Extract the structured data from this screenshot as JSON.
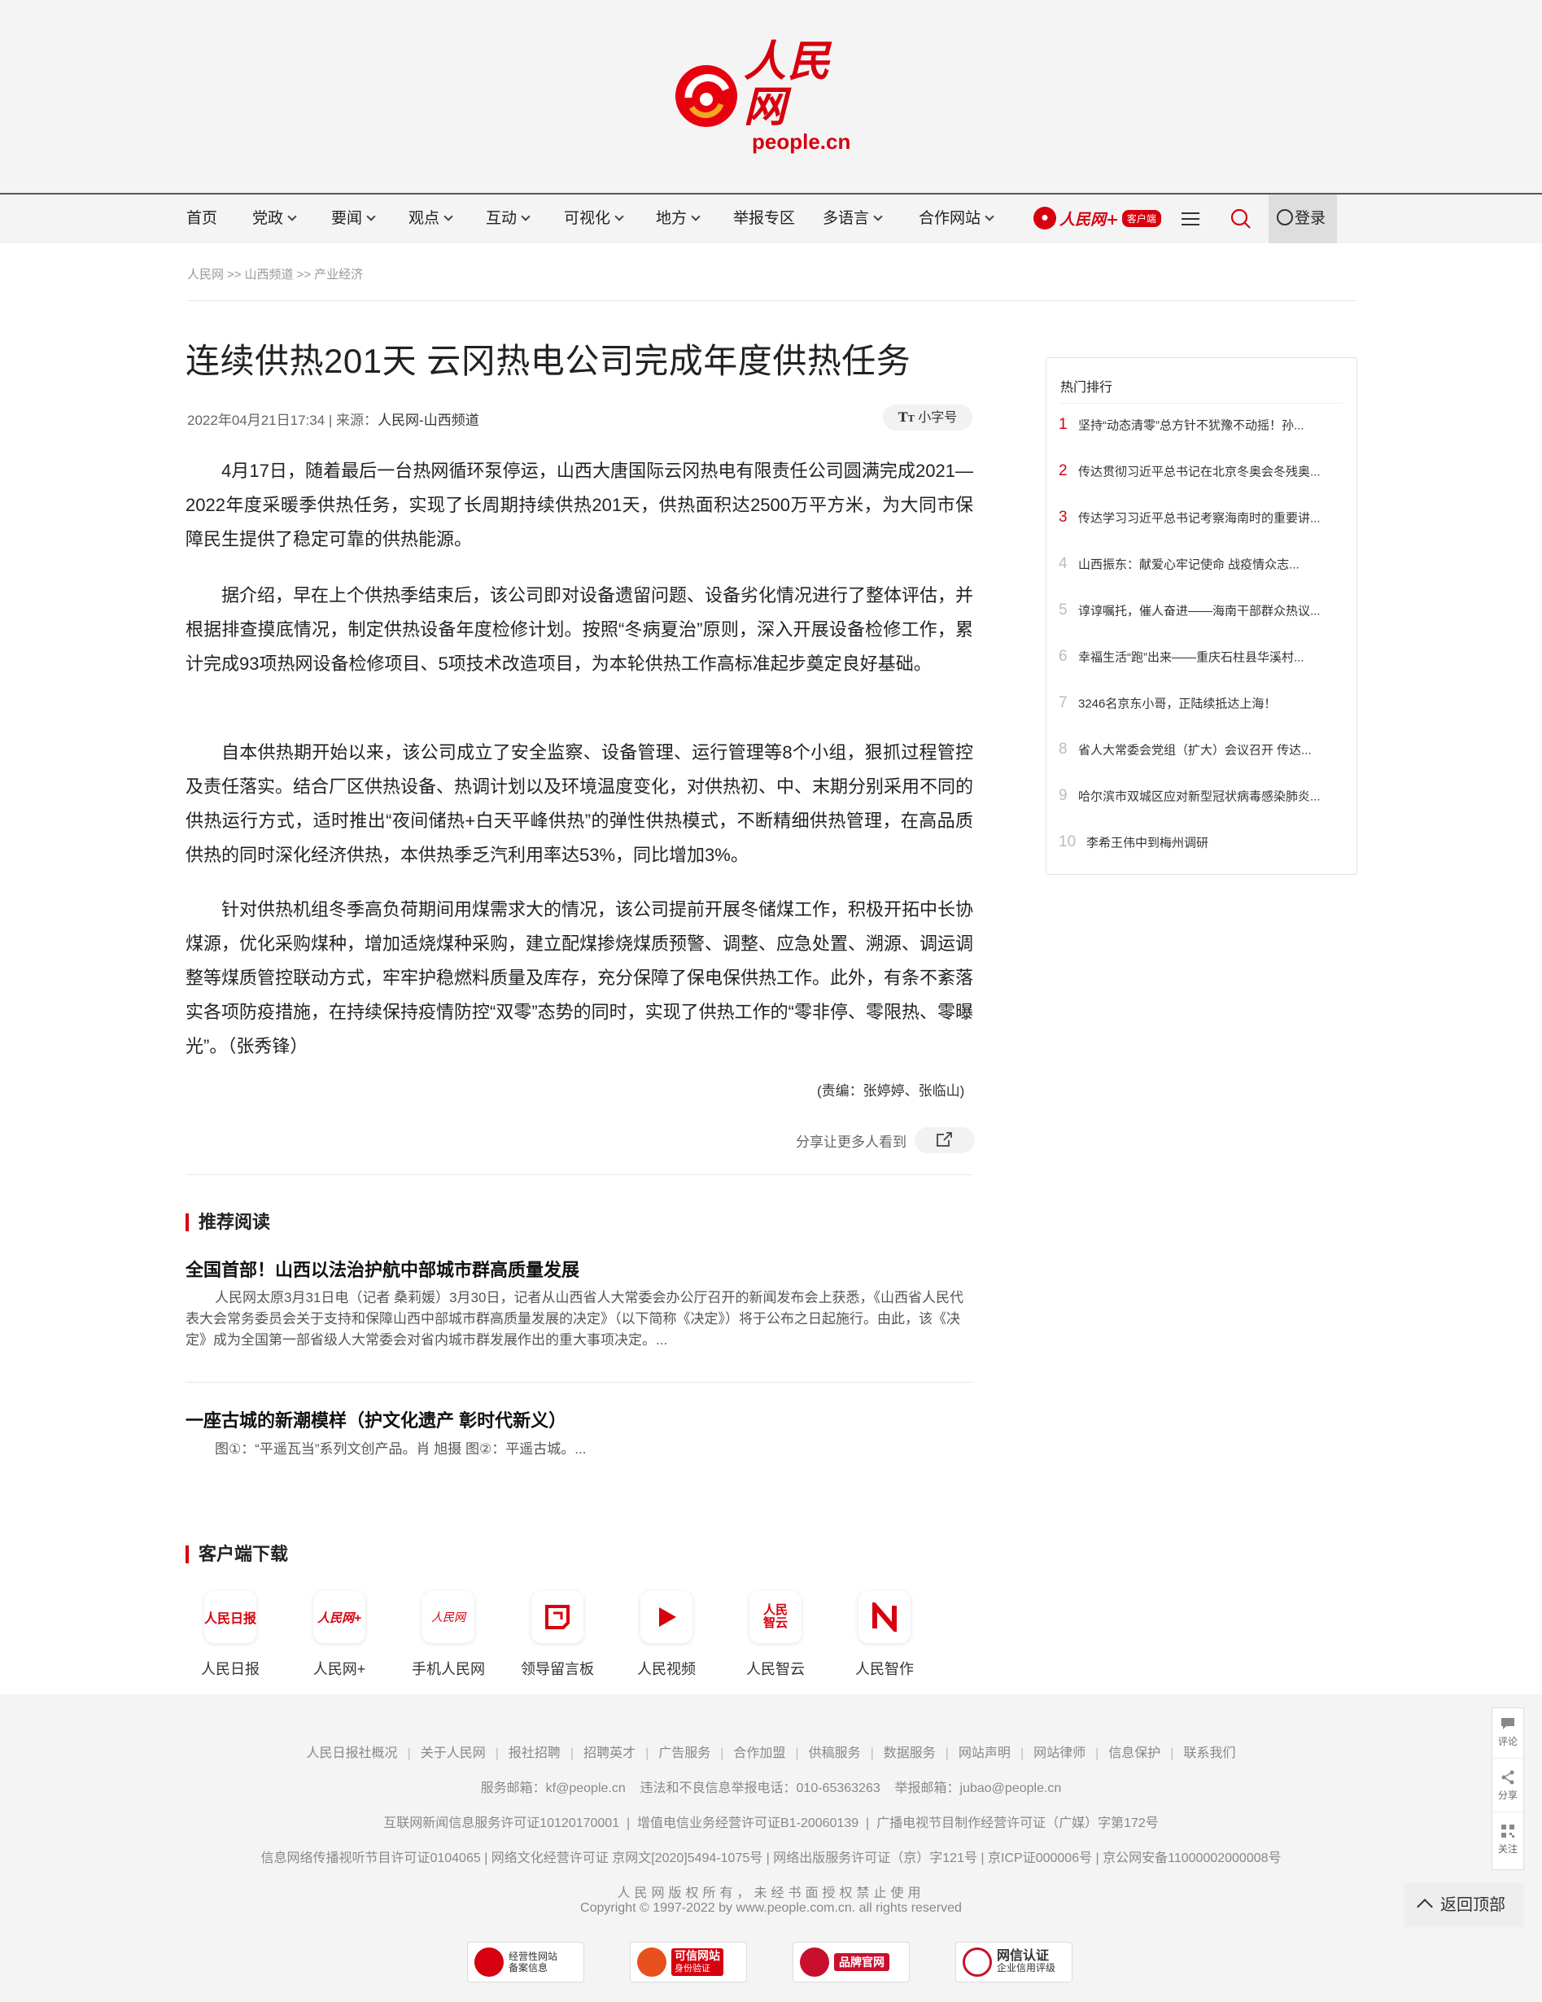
{
  "logo": {
    "cn": "人民网",
    "en": "people.cn"
  },
  "nav": {
    "items": [
      {
        "label": "首页",
        "dropdown": false
      },
      {
        "label": "党政",
        "dropdown": true
      },
      {
        "label": "要闻",
        "dropdown": true
      },
      {
        "label": "观点",
        "dropdown": true
      },
      {
        "label": "互动",
        "dropdown": true
      },
      {
        "label": "可视化",
        "dropdown": true
      },
      {
        "label": "地方",
        "dropdown": true
      },
      {
        "label": "举报专区",
        "dropdown": false
      },
      {
        "label": "多语言",
        "dropdown": true
      },
      {
        "label": "合作网站",
        "dropdown": true
      }
    ],
    "app_name": "人民网+",
    "app_badge": "客户端",
    "login": "登录"
  },
  "breadcrumb": [
    "人民网",
    "山西频道",
    "产业经济"
  ],
  "breadcrumb_sep": ">>",
  "article": {
    "title": "连续供热201天 云冈热电公司完成年度供热任务",
    "date": "2022年04月21日17:34",
    "source_label": "| 来源：",
    "source": "人民网-山西频道",
    "font_toggle": "小字号",
    "paragraphs": [
      "4月17日，随着最后一台热网循环泵停运，山西大唐国际云冈热电有限责任公司圆满完成2021—2022年度采暖季供热任务，实现了长周期持续供热201天，供热面积达2500万平方米，为大同市保障民生提供了稳定可靠的供热能源。",
      "据介绍，早在上个供热季结束后，该公司即对设备遗留问题、设备劣化情况进行了整体评估，并根据排查摸底情况，制定供热设备年度检修计划。按照“冬病夏治”原则，深入开展设备检修工作，累计完成93项热网设备检修项目、5项技术改造项目，为本轮供热工作高标准起步奠定良好基础。",
      "自本供热期开始以来，该公司成立了安全监察、设备管理、运行管理等8个小组，狠抓过程管控及责任落实。结合厂区供热设备、热调计划以及环境温度变化，对供热初、中、末期分别采用不同的供热运行方式，适时推出“夜间储热+白天平峰供热”的弹性供热模式，不断精细供热管理，在高品质供热的同时深化经济供热，本供热季乏汽利用率达53%，同比增加3%。",
      "针对供热机组冬季高负荷期间用煤需求大的情况，该公司提前开展冬储煤工作，积极开拓中长协煤源，优化采购煤种，增加适烧煤种采购，建立配煤掺烧煤质预警、调整、应急处置、溯源、调运调整等煤质管控联动方式，牢牢护稳燃料质量及库存，充分保障了保电保供热工作。此外，有条不紊落实各项防疫措施，在持续保持疫情防控“双零”态势的同时，实现了供热工作的“零非停、零限热、零曝光”。（张秀锋）"
    ],
    "editor": "(责编：张婷婷、张临山)",
    "share_text": "分享让更多人看到"
  },
  "recommend": {
    "heading": "推荐阅读",
    "items": [
      {
        "title": "全国首部！山西以法治护航中部城市群高质量发展",
        "summary": "人民网太原3月31日电（记者 桑莉媛）3月30日，记者从山西省人大常委会办公厅召开的新闻发布会上获悉，《山西省人民代表大会常务委员会关于支持和保障山西中部城市群高质量发展的决定》（以下简称《决定》）将于公布之日起施行。由此，该《决定》成为全国第一部省级人大常委会对省内城市群发展作出的重大事项决定。..."
      },
      {
        "title": "一座古城的新潮模样（护文化遗产 彰时代新义）",
        "summary": "图①：“平遥瓦当”系列文创产品。肖 旭摄 图②：平遥古城。..."
      }
    ]
  },
  "apps": {
    "heading": "客户端下载",
    "items": [
      {
        "label": "人民日报",
        "icon": "people-daily-icon"
      },
      {
        "label": "人民网+",
        "icon": "people-plus-icon"
      },
      {
        "label": "手机人民网",
        "icon": "mobile-people-icon"
      },
      {
        "label": "领导留言板",
        "icon": "leader-message-icon"
      },
      {
        "label": "人民视频",
        "icon": "people-video-icon"
      },
      {
        "label": "人民智云",
        "icon": "people-cloud-icon"
      },
      {
        "label": "人民智作",
        "icon": "people-create-icon"
      }
    ]
  },
  "sidebar": {
    "title": "热门排行",
    "items": [
      "坚持“动态清零”总方针不犹豫不动摇！孙...",
      "传达贯彻习近平总书记在北京冬奥会冬残奥...",
      "传达学习习近平总书记考察海南时的重要讲...",
      "山西振东：献爱心牢记使命  战疫情众志...",
      "谆谆嘱托，催人奋进——海南干部群众热议...",
      "幸福生活“跑”出来——重庆石柱县华溪村...",
      "3246名京东小哥，正陆续抵达上海！",
      "省人大常委会党组（扩大）会议召开 传达...",
      "哈尔滨市双城区应对新型冠状病毒感染肺炎...",
      "李希王伟中到梅州调研"
    ]
  },
  "footer": {
    "links": [
      "人民日报社概况",
      "关于人民网",
      "报社招聘",
      "招聘英才",
      "广告服务",
      "合作加盟",
      "供稿服务",
      "数据服务",
      "网站声明",
      "网站律师",
      "信息保护",
      "联系我们"
    ],
    "contact": "服务邮箱：kf@people.cn    违法和不良信息举报电话：010-65363263    举报邮箱：jubao@people.cn",
    "license1": "互联网新闻信息服务许可证10120170001  |  增值电信业务经营许可证B1-20060139  |  广播电视节目制作经营许可证（广媒）字第172号",
    "license2": "信息网络传播视听节目许可证0104065 | 网络文化经营许可证 京网文[2020]5494-1075号 | 网络出版服务许可证（京）字121号 | 京ICP证000006号 | 京公网安备11000002000008号",
    "copyright1": "人民网版权所有，未经书面授权禁止使用",
    "copyright2": "Copyright © 1997-2022 by www.people.com.cn. all rights reserved",
    "badges": [
      {
        "line1": "经营性网站",
        "line2": "备案信息",
        "color": "#d7000f"
      },
      {
        "line1": "可信网站",
        "line2": "身份验证",
        "color": "#e8501e"
      },
      {
        "line1": "品牌官网",
        "line2": "",
        "color": "#c8102e"
      },
      {
        "line1": "网信认证",
        "line2": "企业信用评级",
        "color": "#c8102e"
      }
    ]
  },
  "float_tools": {
    "comment": "评论",
    "share": "分享",
    "follow": "关注",
    "back_top": "返回顶部"
  }
}
